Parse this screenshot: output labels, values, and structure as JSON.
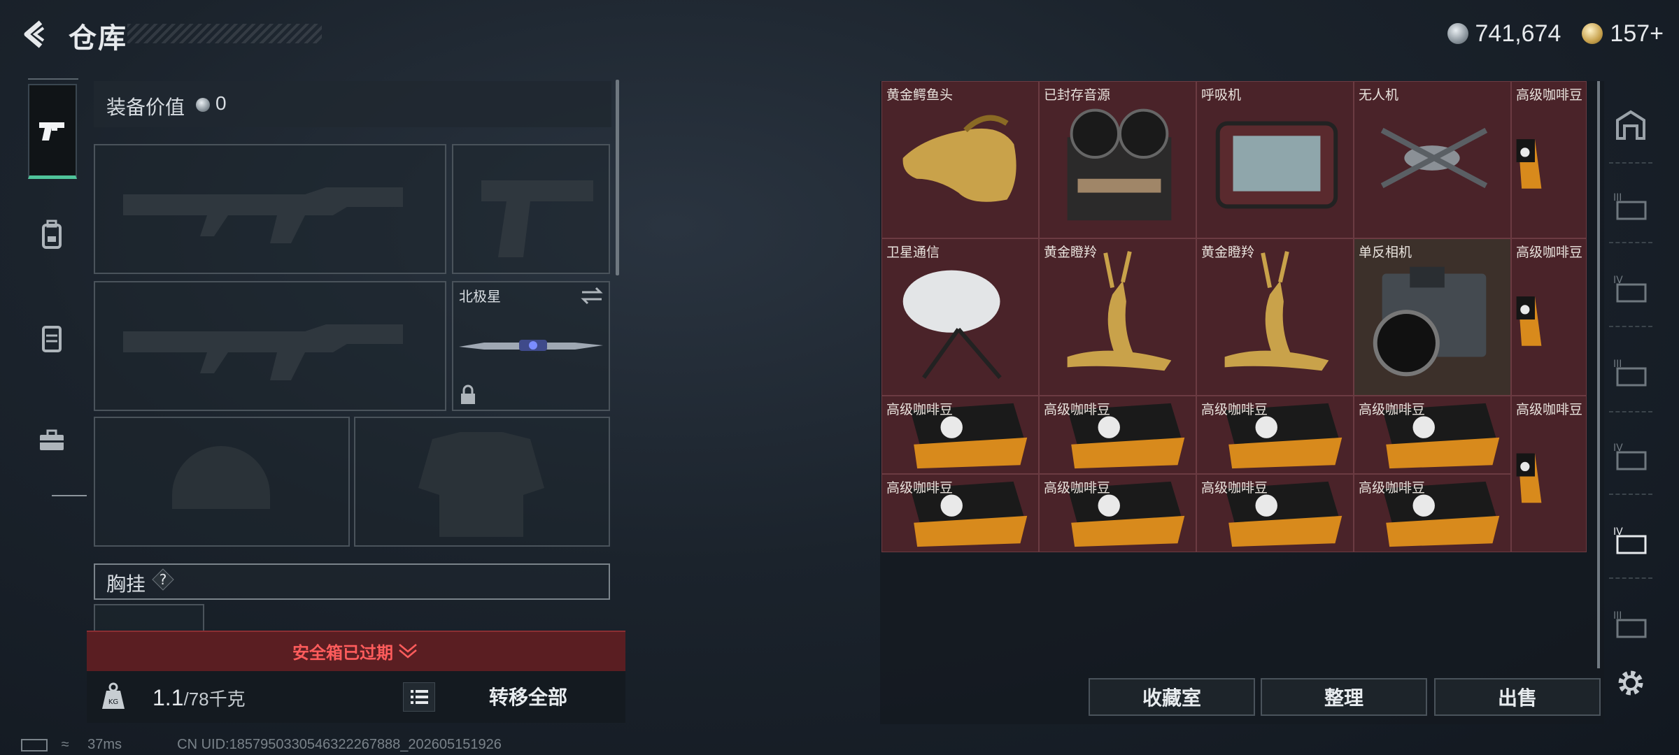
{
  "header": {
    "title": "仓库"
  },
  "currency": {
    "coins": "741,674",
    "premium": "157+"
  },
  "equipment": {
    "value_label": "装备价值",
    "value": "0",
    "melee_name": "北极星",
    "chest_label": "胸挂",
    "chest_hint": "?"
  },
  "safe_box": {
    "text": "安全箱已过期"
  },
  "weight": {
    "current": "1.1",
    "max_unit": "/78千克"
  },
  "buttons": {
    "transfer_all": "转移全部",
    "collection": "收藏室",
    "sort": "整理",
    "sell": "出售"
  },
  "inventory": [
    {
      "name": "黄金鳄鱼头",
      "icon": "gold-crocodile-head"
    },
    {
      "name": "已封存音源",
      "icon": "reel-tape-recorder"
    },
    {
      "name": "呼吸机",
      "icon": "ventilator"
    },
    {
      "name": "无人机",
      "icon": "drone"
    },
    {
      "name": "高级咖啡豆",
      "icon": "coffee-bag"
    },
    {
      "name": "卫星通信",
      "icon": "satellite-dish"
    },
    {
      "name": "黄金瞪羚",
      "icon": "gold-gazelle"
    },
    {
      "name": "黄金瞪羚",
      "icon": "gold-gazelle"
    },
    {
      "name": "单反相机",
      "icon": "camera"
    },
    {
      "name": "高级咖啡豆",
      "icon": "coffee-bag"
    },
    {
      "name": "高级咖啡豆",
      "icon": "coffee-pack"
    },
    {
      "name": "高级咖啡豆",
      "icon": "coffee-pack"
    },
    {
      "name": "高级咖啡豆",
      "icon": "coffee-pack"
    },
    {
      "name": "高级咖啡豆",
      "icon": "coffee-pack"
    },
    {
      "name": "高级咖啡豆",
      "icon": "coffee-bag"
    },
    {
      "name": "高级咖啡豆",
      "icon": "coffee-pack"
    },
    {
      "name": "高级咖啡豆",
      "icon": "coffee-pack"
    },
    {
      "name": "高级咖啡豆",
      "icon": "coffee-pack"
    },
    {
      "name": "高级咖啡豆",
      "icon": "coffee-pack"
    }
  ],
  "status": {
    "ping": "37ms",
    "uid": "CN UID:1857950330546322267888_202605151926"
  },
  "colors": {
    "accent_green": "#4fc39a",
    "warning_red": "#ff5c5c",
    "cell_bg": "#4a2329"
  }
}
